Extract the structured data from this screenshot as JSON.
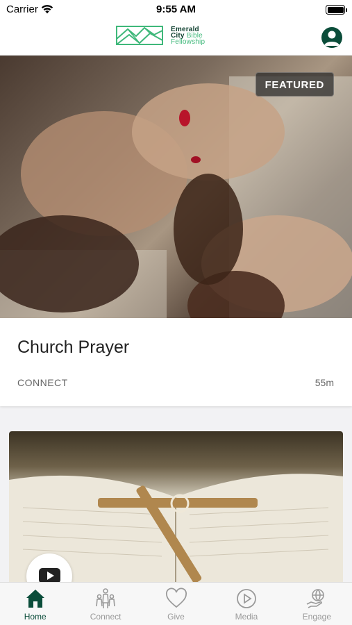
{
  "status_bar": {
    "carrier": "Carrier",
    "time": "9:55 AM"
  },
  "header": {
    "logo_line1": "Emerald",
    "logo_line2_a": "City",
    "logo_line2_b": "Bible",
    "logo_line3": "Fellowship"
  },
  "featured": {
    "badge": "FEATURED",
    "title": "Church Prayer",
    "category": "CONNECT",
    "duration": "55m"
  },
  "tabs": [
    {
      "label": "Home",
      "icon": "home-icon",
      "active": true
    },
    {
      "label": "Connect",
      "icon": "people-icon",
      "active": false
    },
    {
      "label": "Give",
      "icon": "heart-icon",
      "active": false
    },
    {
      "label": "Media",
      "icon": "play-circle-icon",
      "active": false
    },
    {
      "label": "Engage",
      "icon": "hand-globe-icon",
      "active": false
    }
  ],
  "colors": {
    "brand_dark": "#0b4d3a",
    "brand_light": "#3fb87a",
    "tab_inactive": "#9a9a9a"
  }
}
